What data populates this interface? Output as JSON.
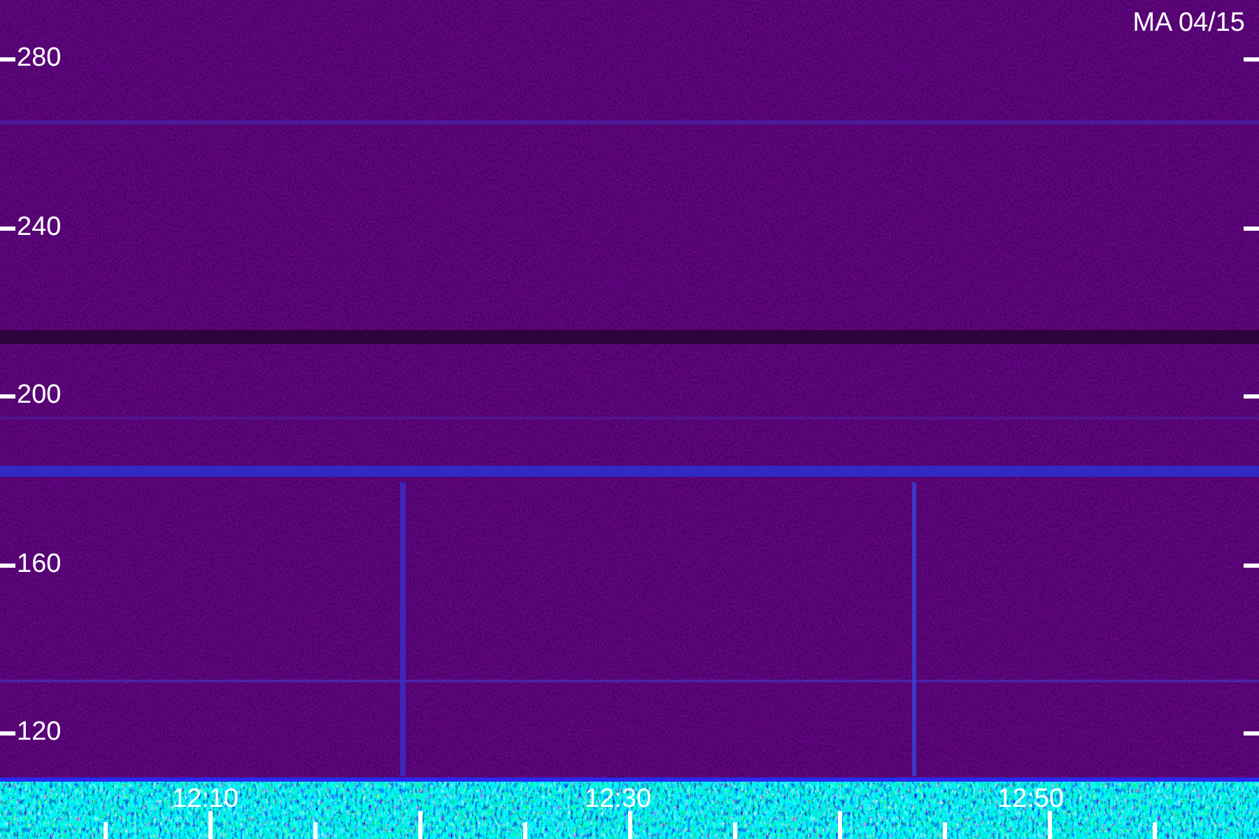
{
  "station_label": "MA 04/15",
  "frequency_axis": {
    "labels": [
      "280",
      "240",
      "200",
      "160",
      "120"
    ]
  },
  "time_axis": {
    "labels": [
      "12:10",
      "12:30",
      "12:50"
    ]
  }
}
